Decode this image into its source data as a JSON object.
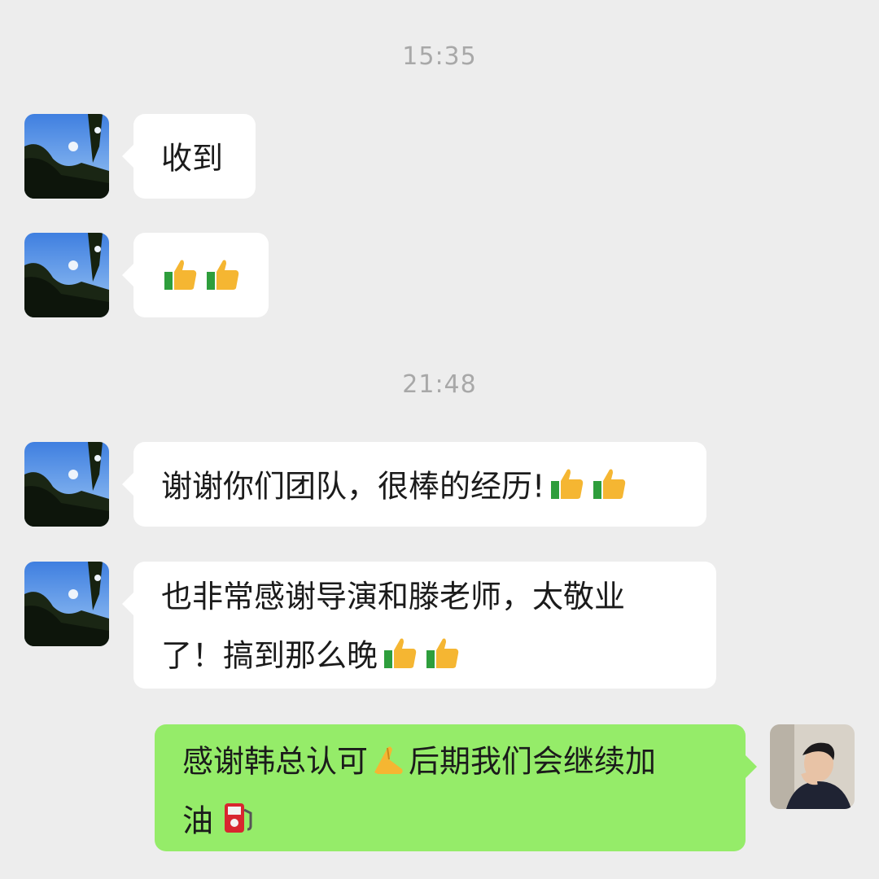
{
  "colors": {
    "background": "#ededed",
    "incoming_bubble": "#ffffff",
    "outgoing_bubble": "#95ec69",
    "timestamp": "#a8a8a8"
  },
  "timestamps": [
    "15:35",
    "21:48"
  ],
  "messages": [
    {
      "sender": "contact",
      "text": "收到",
      "emojis": []
    },
    {
      "sender": "contact",
      "text": "",
      "emojis": [
        "thumbs-up-icon",
        "thumbs-up-icon"
      ]
    },
    {
      "sender": "contact",
      "text": "谢谢你们团队，很棒的经历!",
      "emojis": [
        "thumbs-up-icon",
        "thumbs-up-icon"
      ]
    },
    {
      "sender": "contact",
      "text_line1": "也非常感谢导演和滕老师，太敬业",
      "text_line2": "了！搞到那么晚",
      "emojis": [
        "thumbs-up-icon",
        "thumbs-up-icon"
      ]
    },
    {
      "sender": "me",
      "text_line1a": "感谢韩总认可",
      "emoji_inline": "folded-hands-icon",
      "text_line1b": "后期我们会继续加",
      "text_line2": "油",
      "emoji_end": "fuel-pump-icon"
    }
  ]
}
